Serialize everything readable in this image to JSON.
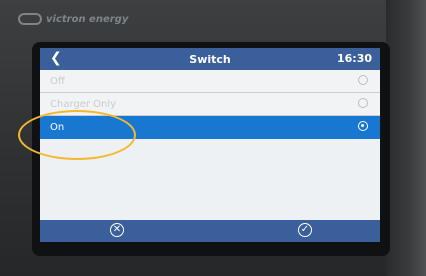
{
  "device": {
    "brand": "victron energy"
  },
  "screen": {
    "title": "Switch",
    "time": "16:30",
    "options": [
      {
        "label": "Off",
        "selected": false
      },
      {
        "label": "Charger Only",
        "selected": false
      },
      {
        "label": "On",
        "selected": true
      }
    ]
  },
  "colors": {
    "header_blue": "#3a5f9a",
    "selection_blue": "#1777d1",
    "annotation_ring": "#f3b92e"
  }
}
